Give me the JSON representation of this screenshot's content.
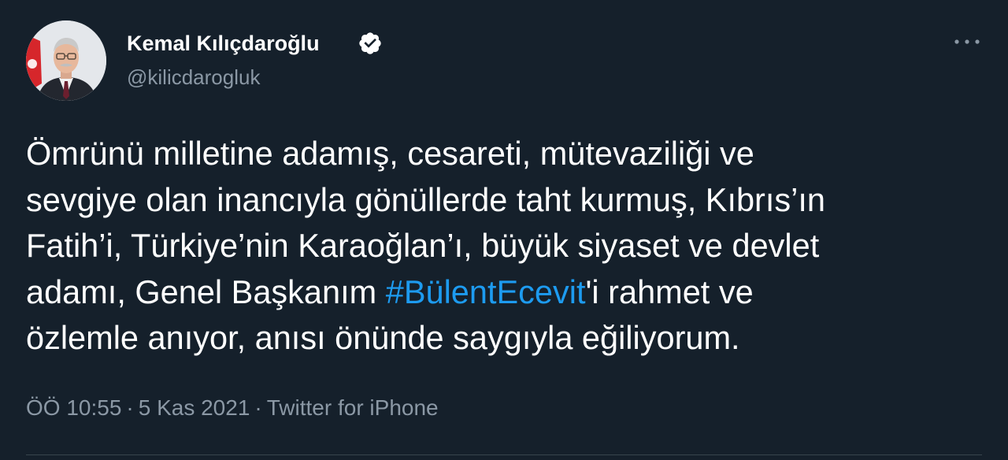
{
  "author": {
    "name": "Kemal Kılıçdaroğlu",
    "handle": "@kilicdarogluk",
    "verified": true,
    "avatar_icon": "profile-photo"
  },
  "tweet": {
    "lines": [
      {
        "text": "Ömrünü milletine adamış, cesareti, mütevaziliği ve"
      },
      {
        "text": "sevgiye olan inancıyla gönüllerde taht kurmuş, Kıbrıs’ın"
      },
      {
        "text": "Fatih’i, Türkiye’nin Karaoğlan’ı, büyük siyaset ve devlet"
      },
      {
        "before": "adamı, Genel Başkanım ",
        "hashtag": "#BülentEcevit",
        "after": "'i rahmet ve"
      },
      {
        "text": "özlemle anıyor, anısı önünde saygıyla eğiliyorum."
      }
    ]
  },
  "meta": {
    "time": "ÖÖ 10:55",
    "separator": "·",
    "date": "5 Kas 2021",
    "source": "Twitter for iPhone"
  },
  "colors": {
    "background": "#15202b",
    "text": "#ffffff",
    "secondary": "#8b98a5",
    "hashtag": "#1d9bf0",
    "divider": "#38444d"
  },
  "icons": {
    "verified": "verified-badge-icon",
    "more": "more-horizontal-icon"
  }
}
